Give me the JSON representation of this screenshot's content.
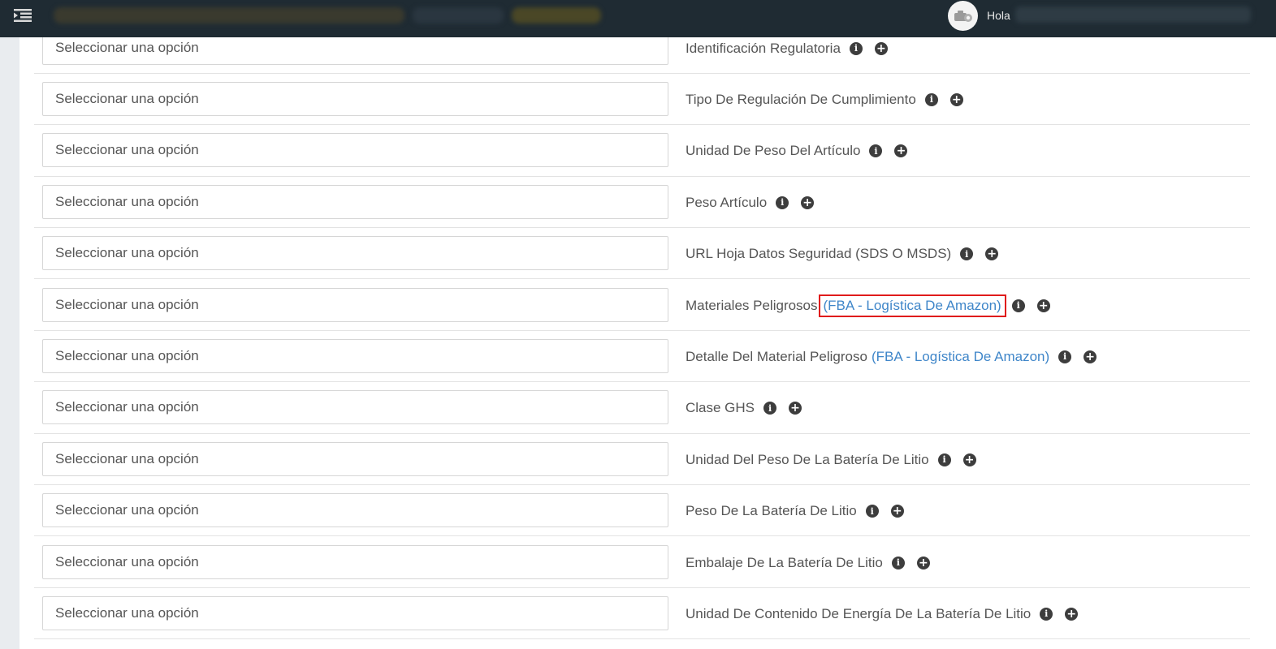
{
  "topbar": {
    "greeting": "Hola",
    "icons": {
      "menu": "menu-toggle-icon",
      "avatar": "user-avatar"
    }
  },
  "rows": [
    {
      "placeholder": "Seleccionar una opción",
      "label": "Identificación Regulatoria",
      "tag": ""
    },
    {
      "placeholder": "Seleccionar una opción",
      "label": "Tipo De Regulación De Cumplimiento",
      "tag": ""
    },
    {
      "placeholder": "Seleccionar una opción",
      "label": "Unidad De Peso Del Artículo",
      "tag": ""
    },
    {
      "placeholder": "Seleccionar una opción",
      "label": "Peso Artículo",
      "tag": ""
    },
    {
      "placeholder": "Seleccionar una opción",
      "label": "URL Hoja Datos Seguridad (SDS O MSDS)",
      "tag": ""
    },
    {
      "placeholder": "Seleccionar una opción",
      "label": "Materiales Peligrosos",
      "tag": "(FBA - Logística De Amazon)",
      "highlighted": true
    },
    {
      "placeholder": "Seleccionar una opción",
      "label": "Detalle Del Material Peligroso",
      "tag": "(FBA - Logística De Amazon)"
    },
    {
      "placeholder": "Seleccionar una opción",
      "label": "Clase GHS",
      "tag": ""
    },
    {
      "placeholder": "Seleccionar una opción",
      "label": "Unidad Del Peso De La Batería De Litio",
      "tag": ""
    },
    {
      "placeholder": "Seleccionar una opción",
      "label": "Peso De La Batería De Litio",
      "tag": ""
    },
    {
      "placeholder": "Seleccionar una opción",
      "label": "Embalaje De La Batería De Litio",
      "tag": ""
    },
    {
      "placeholder": "Seleccionar una opción",
      "label": "Unidad De Contenido De Energía De La Batería De Litio",
      "tag": ""
    }
  ],
  "icons": {
    "info": "info-icon",
    "add": "add-circle-icon"
  },
  "colors": {
    "topbar": "#1f2b33",
    "link": "#3f86c9",
    "highlight": "#e01b1b"
  }
}
